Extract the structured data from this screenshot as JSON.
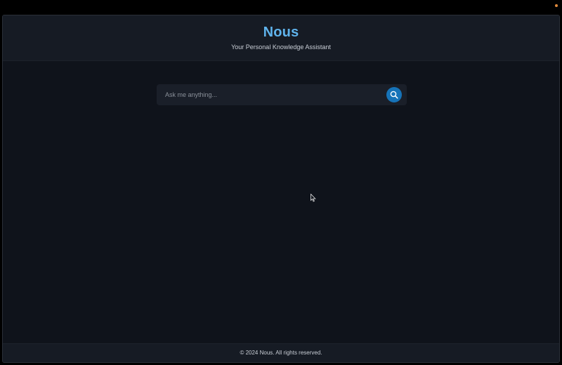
{
  "app": {
    "title": "Nous",
    "subtitle": "Your Personal Knowledge Assistant"
  },
  "search": {
    "placeholder": "Ask me anything...",
    "value": "",
    "button_icon": "search-icon"
  },
  "footer": {
    "text": "© 2024 Nous. All rights reserved."
  },
  "colors": {
    "accent": "#5fb3ec",
    "button": "#1673b8",
    "background": "#0f131b",
    "panel": "#161b24"
  }
}
